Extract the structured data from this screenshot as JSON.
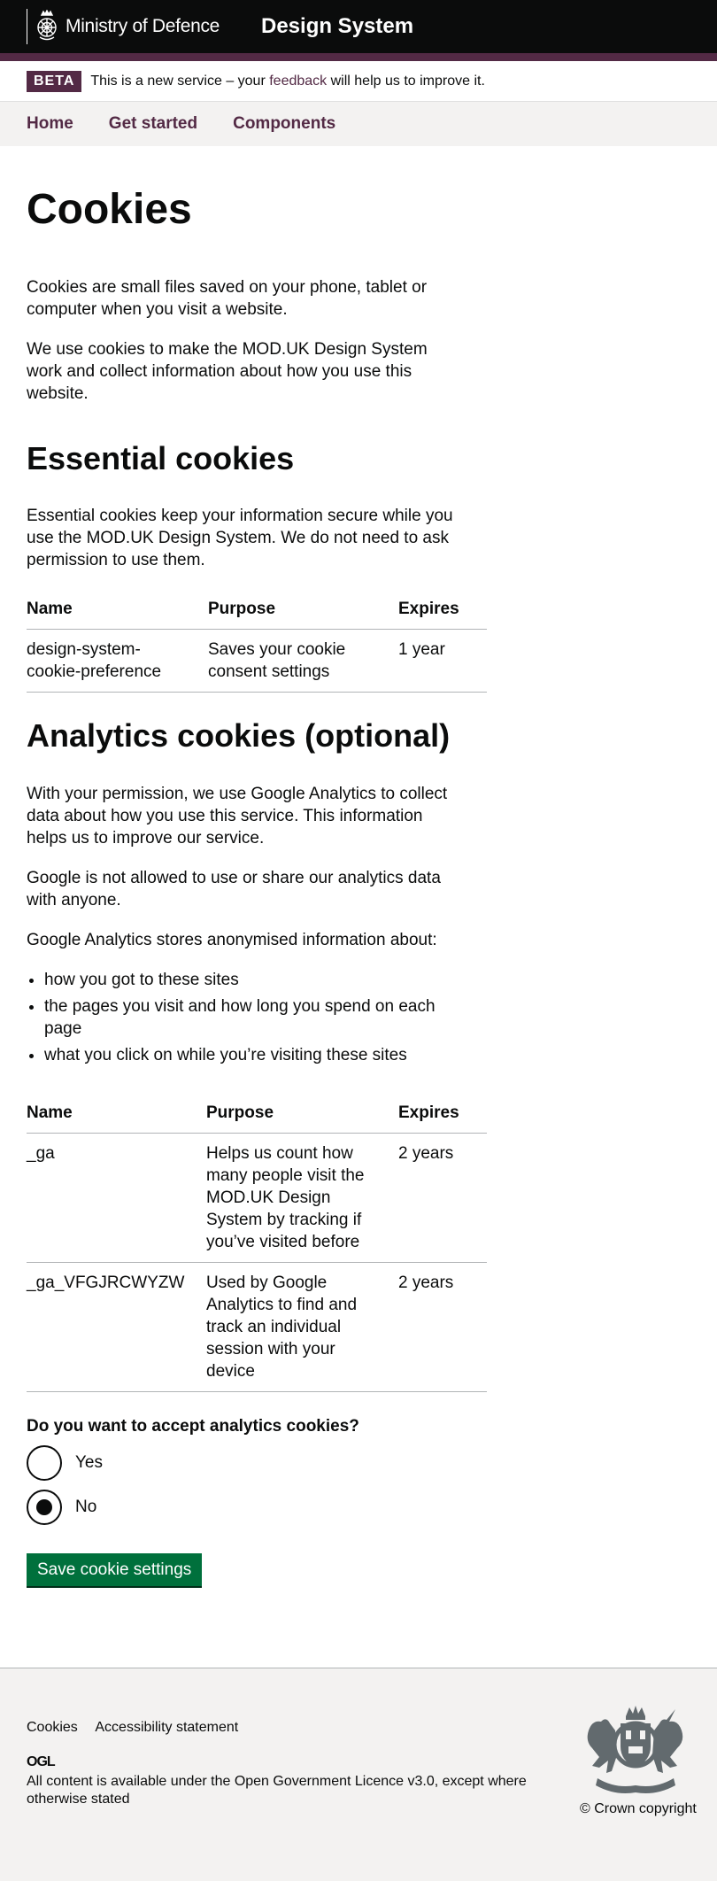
{
  "header": {
    "org_name": "Ministry of Defence",
    "service_name": "Design System"
  },
  "phase_banner": {
    "tag": "BETA",
    "text_before": "This is a new service – your ",
    "link_text": "feedback",
    "text_after": " will help us to improve it."
  },
  "nav": {
    "items": [
      {
        "label": "Home"
      },
      {
        "label": "Get started"
      },
      {
        "label": "Components"
      }
    ]
  },
  "main": {
    "title": "Cookies",
    "intro": [
      "Cookies are small files saved on your phone, tablet or computer when you visit a website.",
      "We use cookies to make the MOD.UK Design System work and collect information about how you use this website."
    ],
    "essential": {
      "heading": "Essential cookies",
      "text": "Essential cookies keep your information secure while you use the MOD.UK Design System. We do not need to ask permission to use them.",
      "table": {
        "headers": [
          "Name",
          "Purpose",
          "Expires"
        ],
        "rows": [
          [
            "design-system-cookie-preference",
            "Saves your cookie consent settings",
            "1 year"
          ]
        ]
      }
    },
    "analytics": {
      "heading": "Analytics cookies (optional)",
      "paragraphs": [
        "With your permission, we use Google Analytics to collect data about how you use this service. This information helps us to improve our service.",
        "Google is not allowed to use or share our analytics data with anyone.",
        "Google Analytics stores anonymised information about:"
      ],
      "bullets": [
        "how you got to these sites",
        "the pages you visit and how long you spend on each page",
        "what you click on while you’re visiting these sites"
      ],
      "table": {
        "headers": [
          "Name",
          "Purpose",
          "Expires"
        ],
        "rows": [
          [
            "_ga",
            "Helps us count how many people visit the MOD.UK Design System by tracking if you’ve visited before",
            "2 years"
          ],
          [
            "_ga_VFGJRCWYZW",
            "Used by Google Analytics to find and track an individual session with your device",
            "2 years"
          ]
        ]
      }
    },
    "form": {
      "question": "Do you want to accept analytics cookies?",
      "options": [
        {
          "label": "Yes",
          "checked": false
        },
        {
          "label": "No",
          "checked": true
        }
      ],
      "submit_label": "Save cookie settings"
    }
  },
  "footer": {
    "links": [
      {
        "label": "Cookies"
      },
      {
        "label": "Accessibility statement"
      }
    ],
    "ogl_logo_text": "OGL",
    "licence_before": "All content is available under the ",
    "licence_link": "Open Government Licence v3.0",
    "licence_after": ", except where otherwise stated",
    "copyright": "© Crown copyright"
  },
  "colors": {
    "header_bg": "#0b0c0c",
    "brand_purple": "#532a45",
    "nav_bg": "#f3f2f1",
    "button_green": "#00703c",
    "text": "#0b0c0c"
  },
  "icons": {
    "org_logo": "mod-crest-icon",
    "footer_crest": "royal-coat-of-arms-icon",
    "licence_logo": "ogl-logo-icon"
  }
}
